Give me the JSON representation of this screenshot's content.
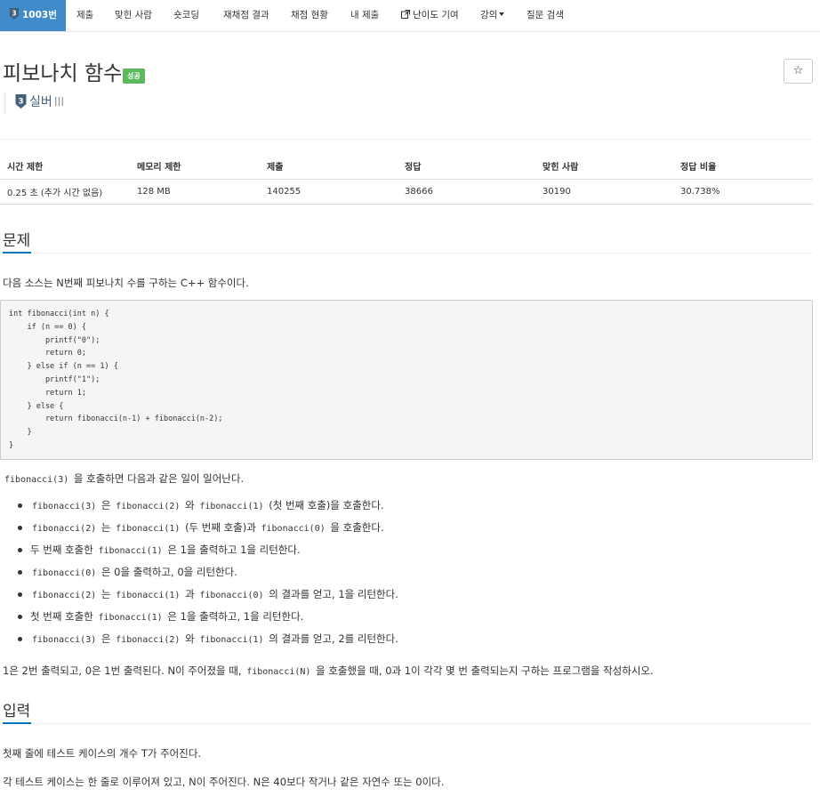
{
  "nav": {
    "problem_badge": "3",
    "problem_id": "1003번",
    "items": [
      "제출",
      "맞힌 사람",
      "숏코딩",
      "재채점 결과",
      "채점 현황",
      "내 제출",
      "난이도 기여",
      "강의",
      "질문 검색"
    ]
  },
  "problem": {
    "title": "피보나치 함수",
    "status_label": "성공",
    "star": "☆",
    "tier_badge": "3",
    "tier_name": "실버",
    "tier_num": "III"
  },
  "info_table": {
    "headers": [
      "시간 제한",
      "메모리 제한",
      "제출",
      "정답",
      "맞힌 사람",
      "정답 비율"
    ],
    "values": [
      "0.25 초 (추가 시간 없음)",
      "128 MB",
      "140255",
      "38666",
      "30190",
      "30.738%"
    ]
  },
  "sections": {
    "problem_head": "문제",
    "input_head": "입력"
  },
  "description": {
    "intro": "다음 소스는 N번째 피보나치 수를 구하는 C++ 함수이다.",
    "code": "int fibonacci(int n) {\n    if (n == 0) {\n        printf(\"0\");\n        return 0;\n    } else if (n == 1) {\n        printf(\"1\");\n        return 1;\n    } else {\n        return fibonacci(n‐1) + fibonacci(n‐2);\n    }\n}",
    "call_line_code": "fibonacci(3)",
    "call_line_text": "을 호출하면 다음과 같은 일이 일어난다.",
    "bullets": [
      [
        {
          "c": "fibonacci(3)"
        },
        {
          "t": "은"
        },
        {
          "c": "fibonacci(2)"
        },
        {
          "t": "와"
        },
        {
          "c": "fibonacci(1)"
        },
        {
          "t": "(첫 번째 호출)을 호출한다."
        }
      ],
      [
        {
          "c": "fibonacci(2)"
        },
        {
          "t": "는"
        },
        {
          "c": "fibonacci(1)"
        },
        {
          "t": "(두 번째 호출)과"
        },
        {
          "c": "fibonacci(0)"
        },
        {
          "t": "을 호출한다."
        }
      ],
      [
        {
          "t": "두 번째 호출한"
        },
        {
          "c": "fibonacci(1)"
        },
        {
          "t": "은 1을 출력하고 1을 리턴한다."
        }
      ],
      [
        {
          "c": "fibonacci(0)"
        },
        {
          "t": "은 0을 출력하고, 0을 리턴한다."
        }
      ],
      [
        {
          "c": "fibonacci(2)"
        },
        {
          "t": "는"
        },
        {
          "c": "fibonacci(1)"
        },
        {
          "t": "과"
        },
        {
          "c": "fibonacci(0)"
        },
        {
          "t": "의 결과를 얻고, 1을 리턴한다."
        }
      ],
      [
        {
          "t": "첫 번째 호출한"
        },
        {
          "c": "fibonacci(1)"
        },
        {
          "t": "은 1을 출력하고, 1을 리턴한다."
        }
      ],
      [
        {
          "c": "fibonacci(3)"
        },
        {
          "t": "은"
        },
        {
          "c": "fibonacci(2)"
        },
        {
          "t": "와"
        },
        {
          "c": "fibonacci(1)"
        },
        {
          "t": "의 결과를 얻고, 2를 리턴한다."
        }
      ]
    ],
    "summary_pre": "1은 2번 출력되고, 0은 1번 출력된다. N이 주어졌을 때,",
    "summary_code": "fibonacci(N)",
    "summary_post": "을 호출했을 때, 0과 1이 각각 몇 번 출력되는지 구하는 프로그램을 작성하시오."
  },
  "input": {
    "line1": "첫째 줄에 테스트 케이스의 개수 T가 주어진다.",
    "line2": "각 테스트 케이스는 한 줄로 이루어져 있고, N이 주어진다. N은 40보다 작거나 같은 자연수 또는 0이다."
  },
  "colors": {
    "nav_active": "#428bca",
    "success": "#5cb85c",
    "tier_silver": "#435f7a",
    "section_underline": "#0076c0"
  }
}
